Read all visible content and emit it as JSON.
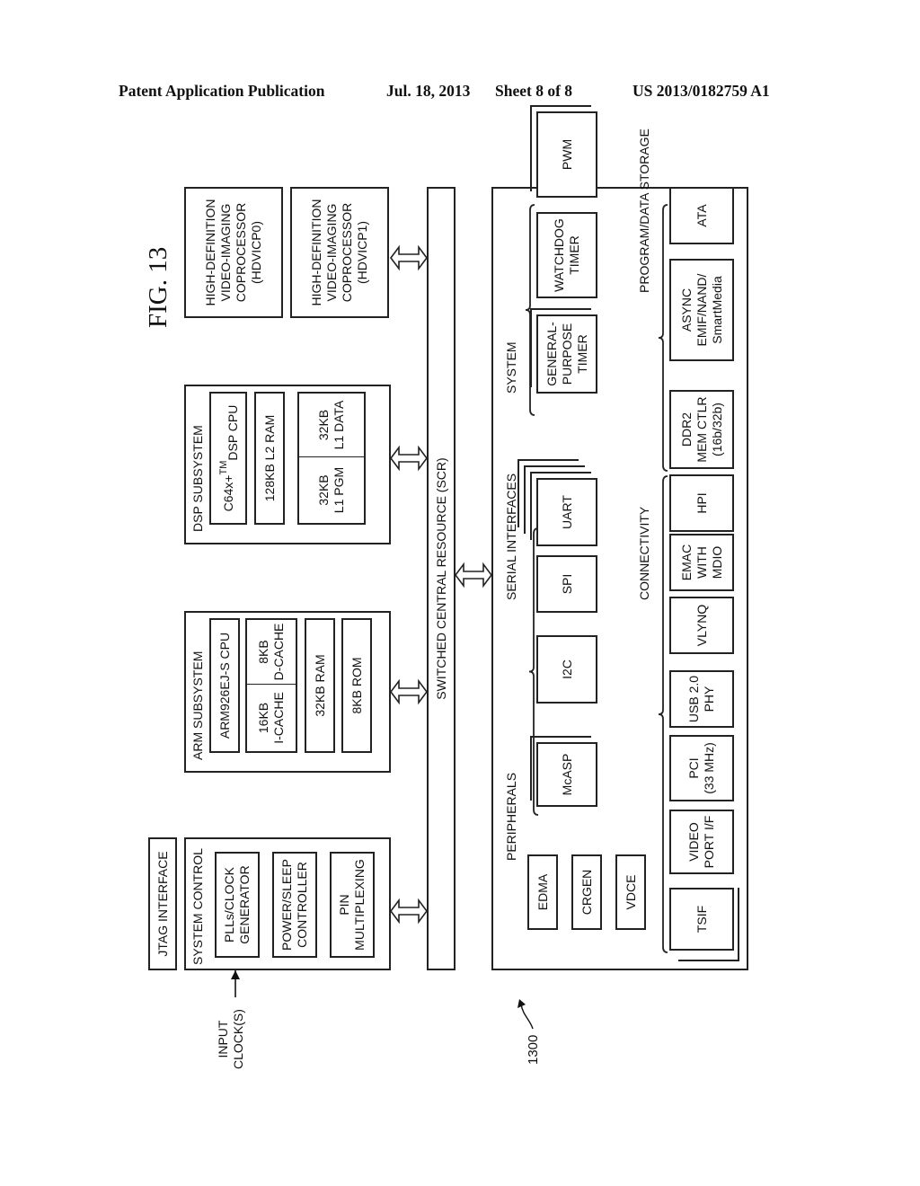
{
  "header": {
    "left": "Patent Application Publication",
    "date": "Jul. 18, 2013",
    "sheet": "Sheet 8 of 8",
    "number": "US 2013/0182759 A1"
  },
  "figure": {
    "title": "FIG. 13",
    "reference": "1300",
    "input_clock": [
      "INPUT",
      "CLOCK(S)"
    ],
    "jtag": "JTAG INTERFACE",
    "system_control": {
      "title": "SYSTEM CONTROL",
      "blocks": [
        [
          "PLLs/CLOCK",
          "GENERATOR"
        ],
        [
          "POWER/SLEEP",
          "CONTROLLER"
        ],
        [
          "PIN",
          "MULTIPLEXING"
        ]
      ]
    },
    "arm": {
      "title": "ARM SUBSYSTEM",
      "cpu": "ARM926EJ-S CPU",
      "icache": [
        "16KB",
        "I-CACHE"
      ],
      "dcache": [
        "8KB",
        "D-CACHE"
      ],
      "ram": "32KB RAM",
      "rom": "8KB ROM"
    },
    "dsp": {
      "title": "DSP SUBSYSTEM",
      "cpu_prefix": "C64x+",
      "cpu_tm": "TM",
      "cpu_suffix": "DSP CPU",
      "l2": "128KB L2 RAM",
      "l1pgm": [
        "32KB",
        "L1 PGM"
      ],
      "l1data": [
        "32KB",
        "L1 DATA"
      ]
    },
    "hdvicp": [
      [
        "HIGH-DEFINITION",
        "VIDEO-IMAGING",
        "COPROCESSOR",
        "(HDVICP0)"
      ],
      [
        "HIGH-DEFINITION",
        "VIDEO-IMAGING",
        "COPROCESSOR",
        "(HDVICP1)"
      ]
    ],
    "scr": "SWITCHED CENTRAL RESOURCE (SCR)",
    "peripherals": {
      "title": "PERIPHERALS",
      "core": [
        "EDMA",
        "CRGEN",
        "VDCE"
      ],
      "serial_title": "SERIAL INTERFACES",
      "serial": [
        "McASP",
        "I2C",
        "SPI",
        "UART"
      ],
      "system_title": "SYSTEM",
      "system": [
        [
          "GENERAL-",
          "PURPOSE",
          "TIMER"
        ],
        [
          "WATCHDOG",
          "TIMER"
        ],
        [
          "PWM"
        ]
      ],
      "connectivity_title": "CONNECTIVITY",
      "connectivity": [
        [
          "TSIF"
        ],
        [
          "VIDEO",
          "PORT I/F"
        ],
        [
          "PCI",
          "(33 MHz)"
        ],
        [
          "USB 2.0",
          "PHY"
        ],
        [
          "VLYNQ"
        ],
        [
          "EMAC",
          "WITH",
          "MDIO"
        ],
        [
          "HPI"
        ]
      ],
      "storage_title": "PROGRAM/DATA STORAGE",
      "storage": [
        [
          "DDR2",
          "MEM CTLR",
          "(16b/32b)"
        ],
        [
          "ASYNC",
          "EMIF/NAND/",
          "SmartMedia"
        ],
        [
          "ATA"
        ]
      ]
    }
  }
}
